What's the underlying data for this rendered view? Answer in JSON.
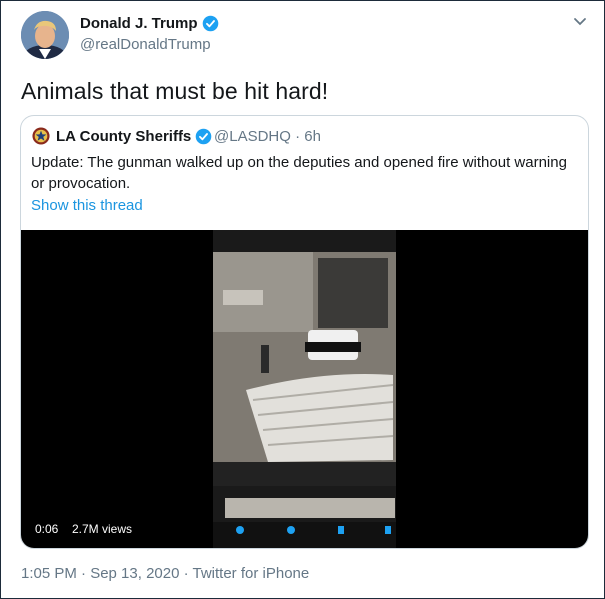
{
  "author": {
    "name": "Donald J. Trump",
    "handle": "@realDonaldTrump",
    "verified": true
  },
  "tweet": {
    "text": "Animals that must be hit hard!"
  },
  "quoted": {
    "name": "LA County Sheriffs",
    "handle_time": "@LASDHQ · 6h",
    "text": "Update: The gunman walked up on the deputies and opened fire without warning or provocation.",
    "link": "Show this thread",
    "video": {
      "duration": "0:06",
      "views": "2.7M views"
    }
  },
  "meta": {
    "footer": "1:05 PM · Sep 13, 2020 · Twitter for iPhone"
  },
  "colors": {
    "link": "#1b95e0",
    "muted": "#657786",
    "verified": "#1da1f2"
  },
  "icons": [
    "chevron-down-icon",
    "verified-badge-icon",
    "sheriff-badge-icon"
  ]
}
